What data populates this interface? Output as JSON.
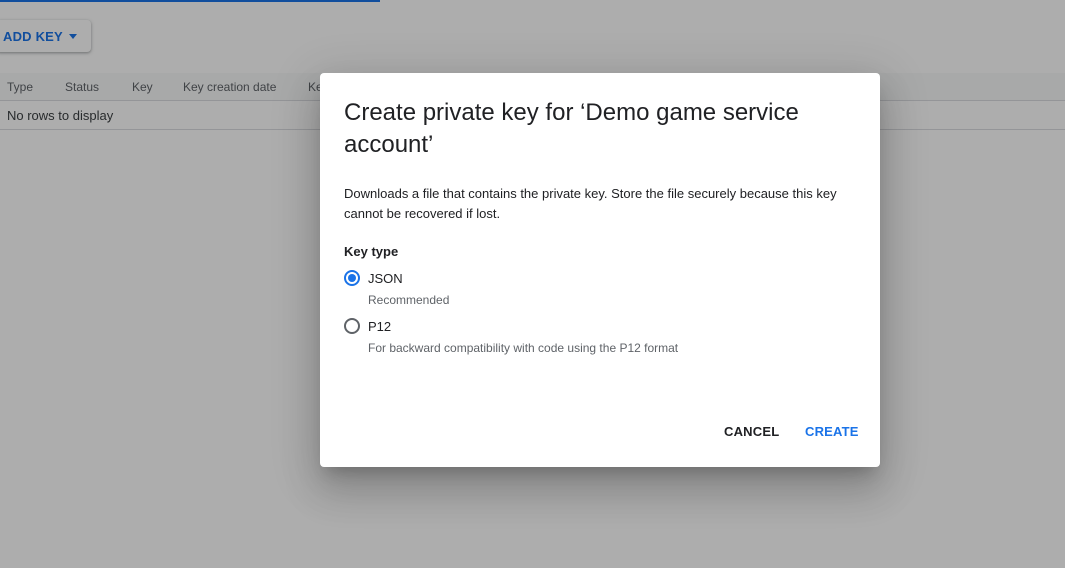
{
  "toolbar": {
    "add_key_label": "ADD KEY",
    "add_key_icon": "caret-down-icon"
  },
  "table": {
    "columns": [
      "Type",
      "Status",
      "Key",
      "Key creation date",
      "Ke"
    ],
    "empty_message": "No rows to display"
  },
  "dialog": {
    "title": "Create private key for ‘Demo game service account’",
    "description": "Downloads a file that contains the private key. Store the file securely because this key cannot be recovered if lost.",
    "key_type_label": "Key type",
    "options": [
      {
        "label": "JSON",
        "sublabel": "Recommended",
        "checked": true
      },
      {
        "label": "P12",
        "sublabel": "For backward compatibility with code using the P12 format",
        "checked": false
      }
    ],
    "cancel_label": "CANCEL",
    "create_label": "CREATE"
  },
  "colors": {
    "accent": "#1a73e8",
    "scrim": "rgba(0,0,0,0.32)"
  }
}
